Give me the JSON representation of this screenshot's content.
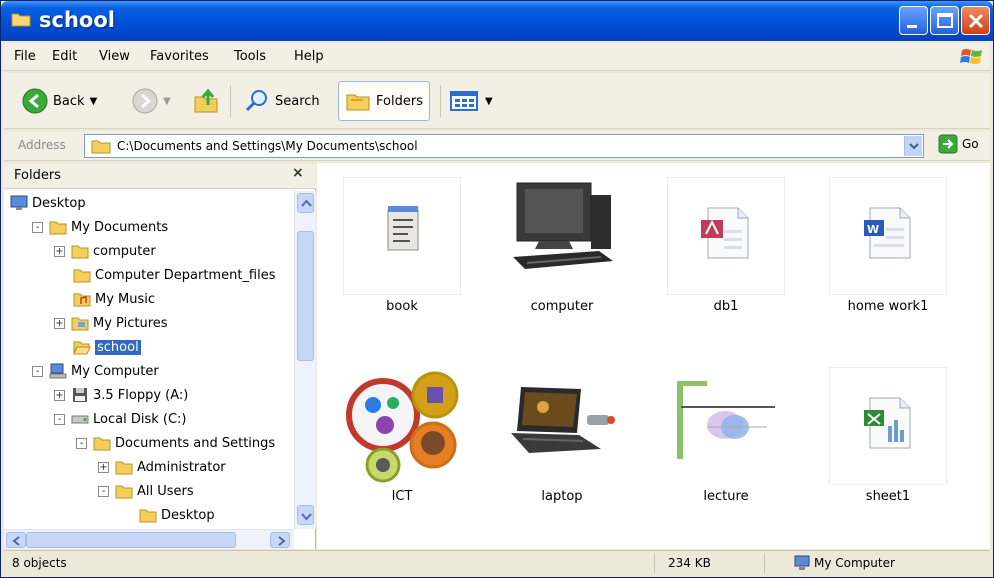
{
  "window": {
    "title": "school"
  },
  "menu": [
    "File",
    "Edit",
    "View",
    "Favorites",
    "Tools",
    "Help"
  ],
  "toolbar": {
    "back_label": "Back",
    "search_label": "Search",
    "folders_label": "Folders"
  },
  "address": {
    "label": "Address",
    "path": "C:\\Documents and Settings\\My Documents\\school",
    "go_label": "Go"
  },
  "folders_pane": {
    "title": "Folders",
    "close_glyph": "×",
    "tree": [
      {
        "label": "Desktop",
        "level": 0,
        "expander": "",
        "icon": "desktop-icon"
      },
      {
        "label": "My Documents",
        "level": 1,
        "expander": "-",
        "icon": "folder-icon"
      },
      {
        "label": "computer",
        "level": 2,
        "expander": "+",
        "icon": "folder-icon"
      },
      {
        "label": "Computer Department_files",
        "level": 2,
        "expander": "",
        "icon": "folder-icon"
      },
      {
        "label": "My Music",
        "level": 2,
        "expander": "",
        "icon": "music-folder-icon"
      },
      {
        "label": "My Pictures",
        "level": 2,
        "expander": "+",
        "icon": "pictures-folder-icon"
      },
      {
        "label": "school",
        "level": 2,
        "expander": "",
        "icon": "folder-open-icon",
        "selected": true
      },
      {
        "label": "My Computer",
        "level": 1,
        "expander": "-",
        "icon": "computer-icon"
      },
      {
        "label": "3.5 Floppy (A:)",
        "level": 2,
        "expander": "+",
        "icon": "floppy-icon"
      },
      {
        "label": "Local Disk (C:)",
        "level": 2,
        "expander": "-",
        "icon": "disk-icon"
      },
      {
        "label": "Documents and Settings",
        "level": 3,
        "expander": "-",
        "icon": "folder-icon"
      },
      {
        "label": "Administrator",
        "level": 4,
        "expander": "+",
        "icon": "folder-icon"
      },
      {
        "label": "All Users",
        "level": 4,
        "expander": "-",
        "icon": "folder-icon"
      },
      {
        "label": "Desktop",
        "level": 5,
        "expander": "",
        "icon": "folder-icon"
      }
    ]
  },
  "files": [
    {
      "name": "book",
      "icon": "notepad-icon"
    },
    {
      "name": "computer",
      "icon": "computer-photo-icon"
    },
    {
      "name": "db1",
      "icon": "access-database-icon"
    },
    {
      "name": "home work1",
      "icon": "word-document-icon"
    },
    {
      "name": "ICT",
      "icon": "ict-collage-icon"
    },
    {
      "name": "laptop",
      "icon": "laptop-photo-icon"
    },
    {
      "name": "lecture",
      "icon": "presentation-icon"
    },
    {
      "name": "sheet1",
      "icon": "excel-sheet-icon"
    }
  ],
  "status": {
    "objects": "8 objects",
    "size": "234 KB",
    "location": "My Computer"
  },
  "colors": {
    "titlebar": "#0050d8",
    "selection": "#316ac5",
    "chrome": "#ece9d8"
  }
}
